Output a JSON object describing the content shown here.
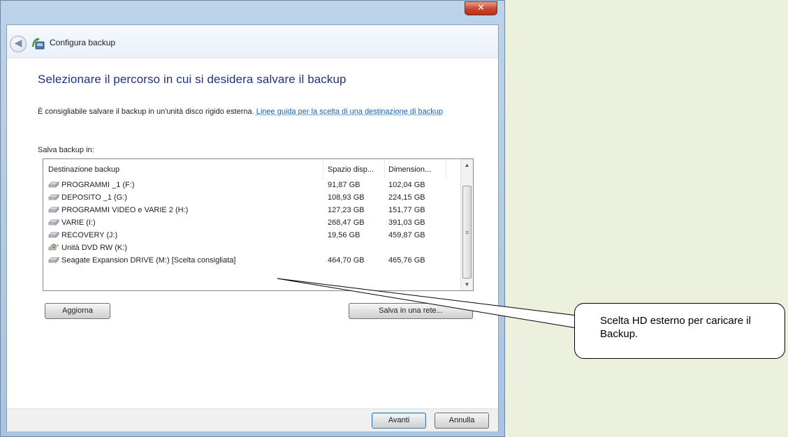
{
  "window": {
    "title": "Configura backup",
    "close_symbol": "✕"
  },
  "page": {
    "heading": "Selezionare il percorso in cui si desidera salvare il backup",
    "description": "È consigliabile salvare il backup in un'unità disco rigido esterna.",
    "link_text": "Linee guida per la scelta di una destinazione di backup",
    "save_in_label": "Salva backup in:"
  },
  "list": {
    "columns": [
      "Destinazione backup",
      "Spazio disp...",
      "Dimension..."
    ],
    "rows": [
      {
        "name": "PROGRAMMI _1 (F:)",
        "space": "91,87 GB",
        "size": "102,04 GB",
        "icon": "hard-drive-icon"
      },
      {
        "name": "DEPOSITO _1 (G:)",
        "space": "108,93 GB",
        "size": "224,15 GB",
        "icon": "hard-drive-icon"
      },
      {
        "name": "PROGRAMMI VIDEO e VARIE 2 (H:)",
        "space": "127,23 GB",
        "size": "151,77 GB",
        "icon": "hard-drive-icon"
      },
      {
        "name": "VARIE (I:)",
        "space": "268,47 GB",
        "size": "391,03 GB",
        "icon": "hard-drive-icon"
      },
      {
        "name": "RECOVERY (J:)",
        "space": "19,56 GB",
        "size": "459,87 GB",
        "icon": "hard-drive-icon"
      },
      {
        "name": "Unità DVD RW (K:)",
        "space": "",
        "size": "",
        "icon": "dvd-drive-icon"
      },
      {
        "name": "Seagate Expansion DRIVE (M:) [Scelta consigliata]",
        "space": "464,70 GB",
        "size": "465,76 GB",
        "icon": "hard-drive-icon"
      }
    ]
  },
  "buttons": {
    "refresh": "Aggiorna",
    "save_network": "Salva in una rete...",
    "next": "Avanti",
    "cancel": "Annulla"
  },
  "callout": {
    "text": "Scelta HD esterno per caricare il Backup."
  }
}
